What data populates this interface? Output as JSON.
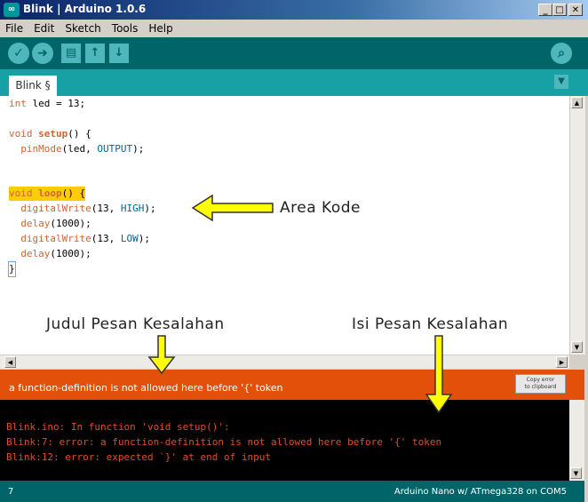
{
  "window": {
    "title": "Blink | Arduino 1.0.6",
    "logo_text": "∞",
    "minimize": "_",
    "maximize": "□",
    "close": "✕"
  },
  "menu": [
    "File",
    "Edit",
    "Sketch",
    "Tools",
    "Help"
  ],
  "toolbar": {
    "verify": "✓",
    "upload": "➜",
    "new": "▤",
    "open": "↑",
    "save": "↓",
    "serial_monitor": "⌕"
  },
  "tab": {
    "label": "Blink §",
    "menu": "▼"
  },
  "code": {
    "l1_a": "int",
    "l1_b": " led = 13;",
    "l3_a": "void ",
    "l3_b": "setup",
    "l3_c": "() {",
    "l4_a": "  ",
    "l4_b": "pinMode",
    "l4_c": "(led, ",
    "l4_d": "OUTPUT",
    "l4_e": ");",
    "l7_a": "void ",
    "l7_b": "loop",
    "l7_c": "() {",
    "l8_a": "  ",
    "l8_b": "digitalWrite",
    "l8_c": "(13, ",
    "l8_d": "HIGH",
    "l8_e": ");",
    "l9_a": "  ",
    "l9_b": "delay",
    "l9_c": "(1000);",
    "l10_a": "  ",
    "l10_b": "digitalWrite",
    "l10_c": "(13, ",
    "l10_d": "LOW",
    "l10_e": ");",
    "l11_a": "  ",
    "l11_b": "delay",
    "l11_c": "(1000);",
    "l12": "}"
  },
  "error": {
    "title": "a function-definition is not allowed here before '{' token",
    "copy_button": "Copy error to clipboard",
    "copy_line1": "Copy error",
    "copy_line2": "to clipboard"
  },
  "console": [
    "Blink.ino: In function 'void setup()':",
    "Blink:7: error: a function-definition is not allowed here before '{' token",
    "Blink:12: error: expected `}' at end of input"
  ],
  "status": {
    "line_number": "7",
    "board": "Arduino Nano w/ ATmega328 on COM5"
  },
  "annotations": {
    "code_area": "Area Kode",
    "error_title": "Judul Pesan Kesalahan",
    "error_content": "Isi Pesan Kesalahan"
  },
  "colors": {
    "toolbar": "#006468",
    "tabbar": "#17a1a5",
    "error_bar": "#e35009",
    "console_text": "#e34c26",
    "arrow": "#ffff00"
  }
}
